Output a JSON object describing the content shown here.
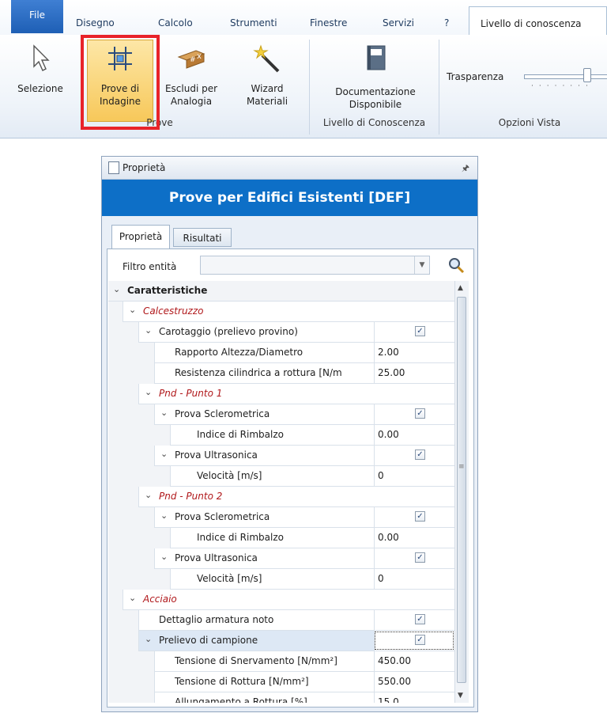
{
  "ribbon_tabs": {
    "file": "File",
    "items": [
      "Disegno",
      "Calcolo",
      "Strumenti",
      "Finestre",
      "Servizi",
      "?"
    ],
    "active": "Livello di conoscenza"
  },
  "ribbon": {
    "selezione": "Selezione",
    "prove_line1": "Prove di",
    "prove_line2": "Indagine",
    "escludi_line1": "Escludi per",
    "escludi_line2": "Analogia",
    "wizard_line1": "Wizard",
    "wizard_line2": "Materiali",
    "doc_line1": "Documentazione",
    "doc_line2": "Disponibile",
    "group_prove": "Prove",
    "group_livello": "Livello di Conoscenza",
    "trasparenza": "Trasparenza",
    "group_opzioni": "Opzioni Vista",
    "accent_color": "#e8232a"
  },
  "panel": {
    "title": "Proprietà",
    "header": "Prove per Edifici Esistenti [DEF]",
    "tab_proprieta": "Proprietà",
    "tab_risultati": "Risultati",
    "filter_label": "Filtro entità",
    "header_color": "#0d6fc7"
  },
  "grid": {
    "caratteristiche": "Caratteristiche",
    "calcestruzzo": "Calcestruzzo",
    "carotaggio": "Carotaggio (prelievo provino)",
    "rapporto": "Rapporto Altezza/Diametro",
    "rapporto_val": "2.00",
    "resistenza": "Resistenza cilindrica a rottura  [N/m",
    "resistenza_val": "25.00",
    "pnd1": "Pnd - Punto 1",
    "scler1": "Prova Sclerometrica",
    "rimbalzo1": "Indice di Rimbalzo",
    "rimbalzo1_val": "0.00",
    "ultra1": "Prova Ultrasonica",
    "vel1": "Velocità  [m/s]",
    "vel1_val": "0",
    "pnd2": "Pnd - Punto 2",
    "scler2": "Prova Sclerometrica",
    "rimbalzo2": "Indice di Rimbalzo",
    "rimbalzo2_val": "0.00",
    "ultra2": "Prova Ultrasonica",
    "vel2": "Velocità  [m/s]",
    "vel2_val": "0",
    "acciaio": "Acciaio",
    "dettaglio": "Dettaglio armatura noto",
    "prelievo": "Prelievo di campione",
    "snervamento": "Tensione di Snervamento  [N/mm²]",
    "snervamento_val": "450.00",
    "rottura": "Tensione di Rottura  [N/mm²]",
    "rottura_val": "550.00",
    "allungamento": "Allungamento a Rottura  [%]",
    "allungamento_val": "15.0",
    "check_mark": "✓"
  }
}
